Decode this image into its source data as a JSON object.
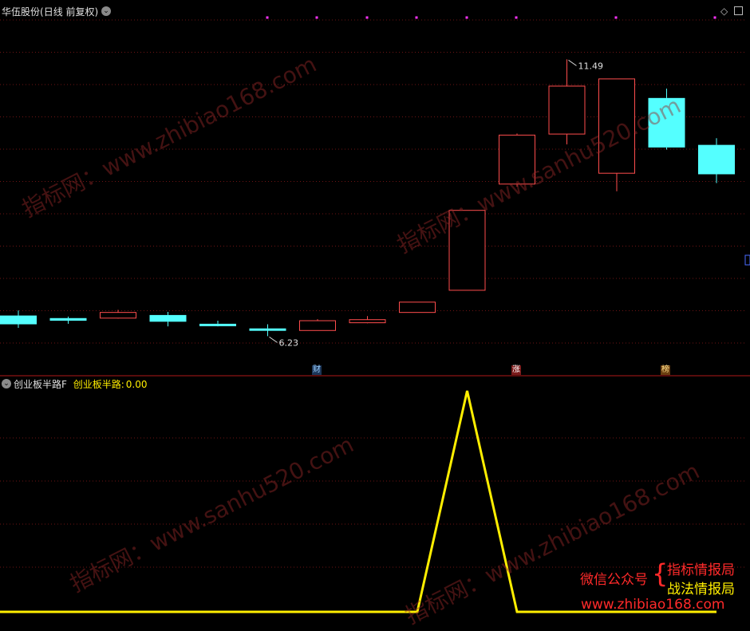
{
  "main_panel": {
    "stock_name": "华伍股份",
    "period_label": "(日线 前复权)",
    "high_label": "11.49",
    "low_label": "6.23",
    "markers": [
      "财",
      "涨",
      "榜"
    ]
  },
  "indicator_panel": {
    "name": "创业板半路F",
    "series_label": "创业板半路:",
    "series_value": "0.00"
  },
  "watermarks": [
    "指标网：www.zhibiao168.com",
    "指标网：www.sanhu520.com"
  ],
  "footer": {
    "left": "微信公众号",
    "line1": "指标情报局",
    "line2": "战法情报局",
    "url": "www.zhibiao168.com"
  },
  "colors": {
    "up": "#ff4d4d",
    "down": "#54ffff",
    "indicator": "#ffee00",
    "grid": "#6e1414",
    "label": "#e0e0e0",
    "footer_red": "#ff2a2a",
    "footer_yellow": "#ffee00"
  },
  "chart_data": [
    {
      "type": "candlestick",
      "title": "华伍股份(日线 前复权)",
      "ylim": [
        5.6,
        12.3
      ],
      "candles": [
        {
          "open": 6.52,
          "high": 6.62,
          "low": 6.28,
          "close": 6.35
        },
        {
          "open": 6.47,
          "high": 6.5,
          "low": 6.36,
          "close": 6.42
        },
        {
          "open": 6.47,
          "high": 6.63,
          "low": 6.46,
          "close": 6.58
        },
        {
          "open": 6.53,
          "high": 6.59,
          "low": 6.31,
          "close": 6.4
        },
        {
          "open": 6.36,
          "high": 6.42,
          "low": 6.31,
          "close": 6.33
        },
        {
          "open": 6.27,
          "high": 6.35,
          "low": 6.12,
          "close": 6.24
        },
        {
          "open": 6.23,
          "high": 6.45,
          "low": 6.23,
          "close": 6.42
        },
        {
          "open": 6.38,
          "high": 6.51,
          "low": 6.37,
          "close": 6.44
        },
        {
          "open": 6.58,
          "high": 6.78,
          "low": 6.58,
          "close": 6.78
        },
        {
          "open": 7.01,
          "high": 8.56,
          "low": 7.01,
          "close": 8.56
        },
        {
          "open": 9.07,
          "high": 10.05,
          "low": 9.02,
          "close": 10.02
        },
        {
          "open": 10.04,
          "high": 11.49,
          "low": 9.84,
          "close": 10.97
        },
        {
          "open": 9.28,
          "high": 10.46,
          "low": 8.93,
          "close": 11.11
        },
        {
          "open": 10.74,
          "high": 10.92,
          "low": 9.74,
          "close": 9.78
        },
        {
          "open": 9.83,
          "high": 9.96,
          "low": 9.09,
          "close": 9.26
        }
      ],
      "markers": [
        {
          "index": 6,
          "label": "财"
        },
        {
          "index": 10,
          "label": "涨"
        },
        {
          "index": 13,
          "label": "榜"
        }
      ]
    },
    {
      "type": "line",
      "series": [
        {
          "name": "创业板半路",
          "values": [
            0,
            0,
            0,
            0,
            0,
            0,
            0,
            0,
            0,
            1,
            0,
            0,
            0,
            0,
            0
          ]
        }
      ],
      "ylim": [
        0,
        1.0
      ]
    }
  ]
}
